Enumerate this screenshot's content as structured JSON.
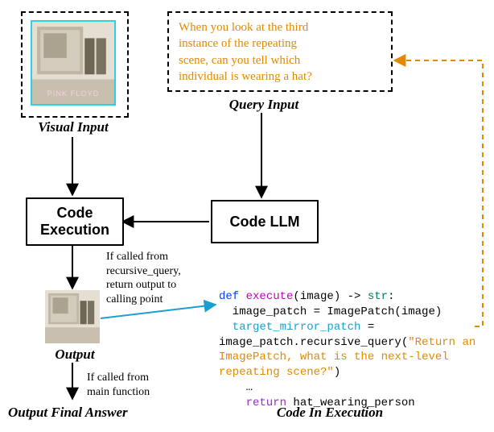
{
  "visual_input": {
    "label": "Visual Input"
  },
  "query_input": {
    "label": "Query Input",
    "text_lines": [
      "When you look at the third",
      "instance of the repeating",
      "scene, can you tell which",
      "individual is wearing a hat?"
    ]
  },
  "code_execution": {
    "label": "Code\nExecution"
  },
  "code_llm": {
    "label": "Code LLM"
  },
  "cond_text_lines": [
    "If called from",
    "recursive_query,",
    "return output to",
    "calling point"
  ],
  "output": {
    "label": "Output"
  },
  "main_cond_lines": [
    "If called from",
    "main function"
  ],
  "final_answer": {
    "label": "Output Final Answer"
  },
  "code_in_exec": {
    "label": "Code In Execution"
  },
  "code": {
    "l1_def": "def ",
    "l1_fn": "execute",
    "l1_sig": "(image) -> ",
    "l1_type": "str",
    "l1_colon": ":",
    "l2": "  image_patch = ImagePatch(image)",
    "l3_var": "  target_mirror_patch",
    "l3_eq": " =",
    "l4a": "image_patch.recursive_query(",
    "l4s": "\"Return an",
    "l5s": "ImagePatch, what is the next-level",
    "l6s": "repeating scene?\"",
    "l6b": ")",
    "l7": "    …",
    "l8_ret": "    return",
    "l8_tail": " hat_wearing_person"
  }
}
